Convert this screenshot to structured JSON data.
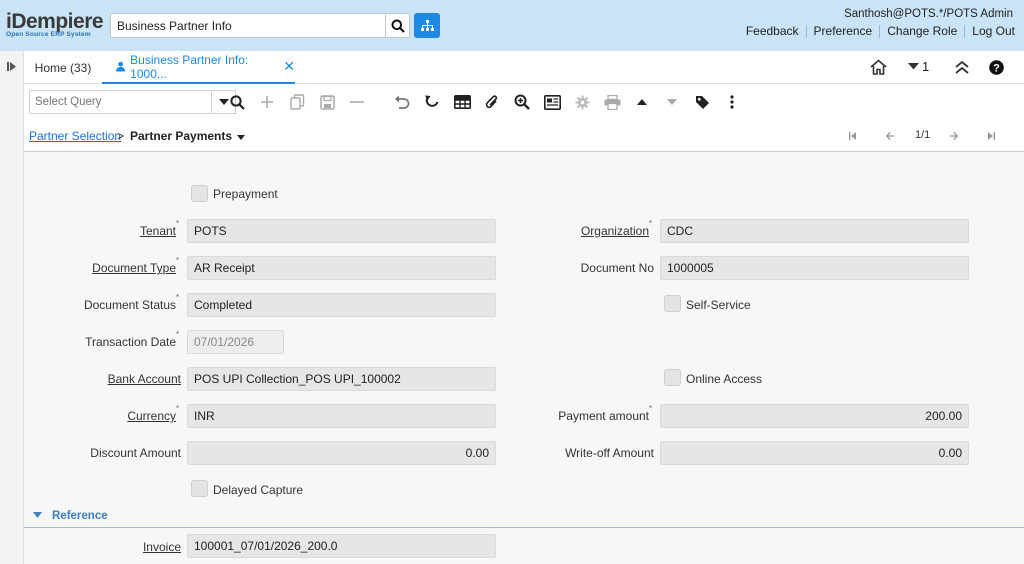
{
  "header": {
    "logo_main": "iDempiere",
    "logo_sub": "Open Source ERP System",
    "search_value": "Business Partner Info",
    "user": "Santhosh@POTS.*/POTS Admin",
    "links": [
      "Feedback",
      "Preference",
      "Change Role",
      "Log Out"
    ]
  },
  "tabs": {
    "home": "Home (33)",
    "active": "Business Partner Info: 1000...",
    "count": "1"
  },
  "toolbar": {
    "query_placeholder": "Select Query"
  },
  "breadcrumb": {
    "parent": "Partner Selection",
    "separator": ">",
    "current": "Partner Payments",
    "record": "1/1"
  },
  "form": {
    "prepayment": "Prepayment",
    "tenant_label": "Tenant",
    "tenant_value": "POTS",
    "org_label": "Organization",
    "org_value": "CDC",
    "doctype_label": "Document Type",
    "doctype_value": "AR Receipt",
    "docno_label": "Document No",
    "docno_value": "1000005",
    "docstatus_label": "Document Status",
    "docstatus_value": "Completed",
    "selfservice": "Self-Service",
    "trxdate_label": "Transaction Date",
    "trxdate_value": "07/01/2026",
    "bank_label": "Bank Account",
    "bank_value": "POS UPI Collection_POS UPI_100002",
    "online_access": "Online Access",
    "currency_label": "Currency",
    "currency_value": "INR",
    "payamt_label": "Payment amount",
    "payamt_value": "200.00",
    "discount_label": "Discount Amount",
    "discount_value": "0.00",
    "writeoff_label": "Write-off Amount",
    "writeoff_value": "0.00",
    "delayed_capture": "Delayed Capture",
    "reference_section": "Reference",
    "invoice_label": "Invoice",
    "invoice_value": "100001_07/01/2026_200.0"
  },
  "colors": {
    "header_bg": "#c9e4f7",
    "accent": "#1e88e5",
    "form_bg": "#f7f7f7",
    "field_bg": "#e6e6e6"
  }
}
